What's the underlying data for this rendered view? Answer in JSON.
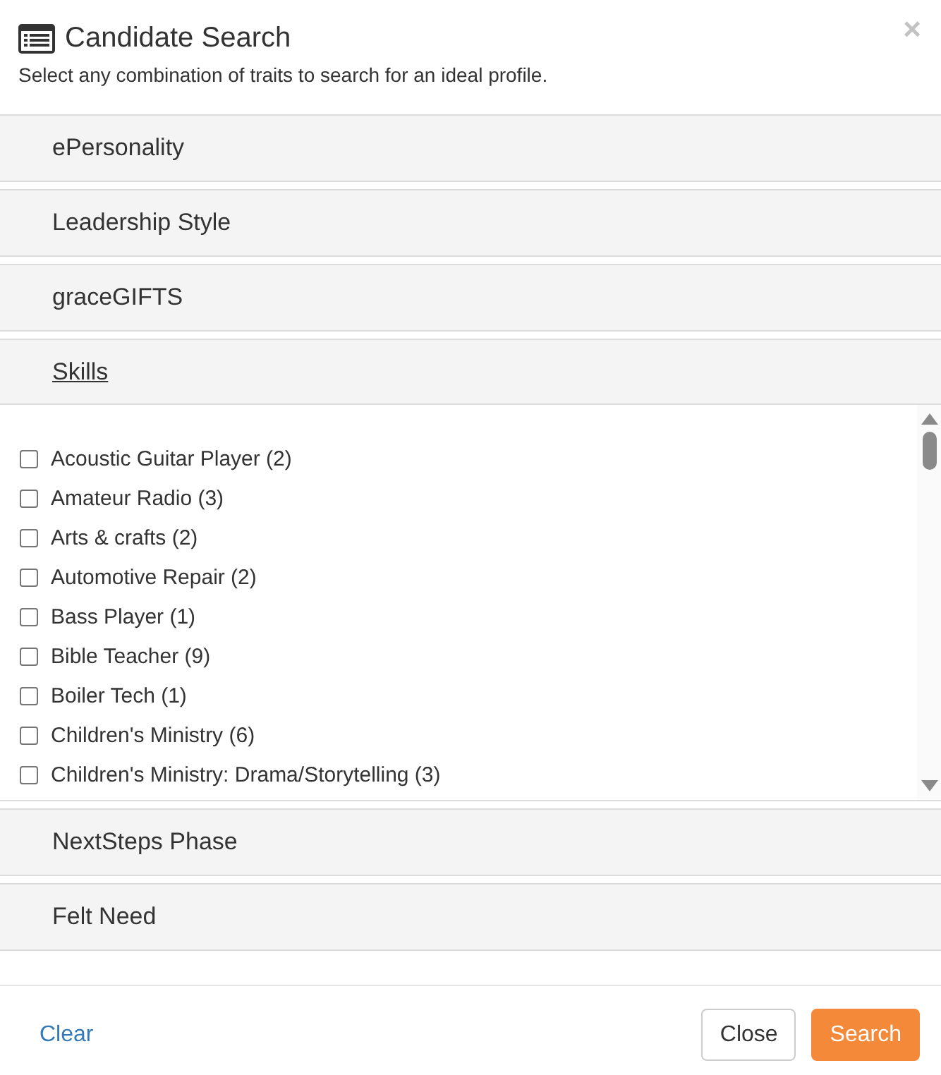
{
  "dialog": {
    "title": "Candidate Search",
    "close_glyph": "×",
    "subtitle": "Select any combination of traits to search for an ideal profile."
  },
  "panels": [
    {
      "title": "ePersonality",
      "expanded": false
    },
    {
      "title": "Leadership Style",
      "expanded": false
    },
    {
      "title": "graceGIFTS",
      "expanded": false
    },
    {
      "title": "Skills",
      "expanded": true,
      "options": [
        {
          "label": "Acoustic Guitar Player (2)",
          "checked": false
        },
        {
          "label": "Amateur Radio (3)",
          "checked": false
        },
        {
          "label": "Arts & crafts (2)",
          "checked": false
        },
        {
          "label": "Automotive Repair (2)",
          "checked": false
        },
        {
          "label": "Bass Player (1)",
          "checked": false
        },
        {
          "label": "Bible Teacher (9)",
          "checked": false
        },
        {
          "label": "Boiler Tech (1)",
          "checked": false
        },
        {
          "label": "Children's Ministry (6)",
          "checked": false
        },
        {
          "label": "Children's Ministry: Drama/Storytelling (3)",
          "checked": false
        }
      ]
    },
    {
      "title": "NextSteps Phase",
      "expanded": false
    },
    {
      "title": "Felt Need",
      "expanded": false
    }
  ],
  "footer": {
    "link": "Clear",
    "buttons": [
      {
        "label": "Close",
        "kind": "default"
      },
      {
        "label": "Search",
        "kind": "primary"
      }
    ]
  }
}
